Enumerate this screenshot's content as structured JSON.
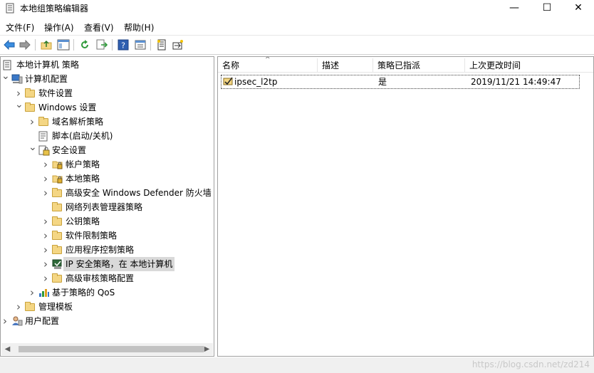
{
  "window": {
    "title": "本地组策略编辑器",
    "buttons": {
      "minimize": "—",
      "maximize": "☐",
      "close": "✕"
    }
  },
  "menu": [
    "文件(F)",
    "操作(A)",
    "查看(V)",
    "帮助(H)"
  ],
  "toolbar": {
    "icons": [
      "back-arrow-icon",
      "forward-arrow-icon",
      "up-folder-icon",
      "show-hide-tree-icon",
      "refresh-icon",
      "export-list-icon",
      "help-icon",
      "properties-icon",
      "filter-icon",
      "new-policy-icon"
    ]
  },
  "tree": {
    "items": [
      {
        "label": "本地计算机 策略",
        "level": 0,
        "arrow": "",
        "icon": "policy-doc-icon"
      },
      {
        "label": "计算机配置",
        "level": 0,
        "arrow": "v",
        "icon": "computer-icon"
      },
      {
        "label": "软件设置",
        "level": 1,
        "arrow": ">",
        "icon": "folder-icon"
      },
      {
        "label": "Windows 设置",
        "level": 1,
        "arrow": "v",
        "icon": "folder-icon"
      },
      {
        "label": "域名解析策略",
        "level": 2,
        "arrow": ">",
        "icon": "folder-icon"
      },
      {
        "label": "脚本(启动/关机)",
        "level": 2,
        "arrow": "",
        "icon": "script-icon"
      },
      {
        "label": "安全设置",
        "level": 2,
        "arrow": "v",
        "icon": "security-settings-icon"
      },
      {
        "label": "帐户策略",
        "level": 3,
        "arrow": ">",
        "icon": "lock-folder-icon"
      },
      {
        "label": "本地策略",
        "level": 3,
        "arrow": ">",
        "icon": "lock-folder-icon"
      },
      {
        "label": "高级安全 Windows Defender 防火墙",
        "level": 3,
        "arrow": ">",
        "icon": "folder-icon"
      },
      {
        "label": "网络列表管理器策略",
        "level": 3,
        "arrow": "",
        "icon": "folder-icon"
      },
      {
        "label": "公钥策略",
        "level": 3,
        "arrow": ">",
        "icon": "folder-icon"
      },
      {
        "label": "软件限制策略",
        "level": 3,
        "arrow": ">",
        "icon": "folder-icon"
      },
      {
        "label": "应用程序控制策略",
        "level": 3,
        "arrow": ">",
        "icon": "folder-icon"
      },
      {
        "label": "IP 安全策略，在 本地计算机",
        "level": 3,
        "arrow": ">",
        "icon": "ip-security-icon",
        "selected": true
      },
      {
        "label": "高级审核策略配置",
        "level": 3,
        "arrow": ">",
        "icon": "folder-icon"
      },
      {
        "label": "基于策略的 QoS",
        "level": 2,
        "arrow": ">",
        "icon": "qos-chart-icon"
      },
      {
        "label": "管理模板",
        "level": 1,
        "arrow": ">",
        "icon": "folder-icon"
      },
      {
        "label": "用户配置",
        "level": 0,
        "arrow": ">",
        "icon": "user-icon"
      }
    ]
  },
  "list": {
    "columns": [
      "名称",
      "描述",
      "策略已指派",
      "上次更改时间"
    ],
    "rows": [
      {
        "name": "ipsec_l2tp",
        "description": "",
        "assigned": "是",
        "modified": "2019/11/21 14:49:47"
      }
    ]
  },
  "watermark": "https://blog.csdn.net/zd214"
}
